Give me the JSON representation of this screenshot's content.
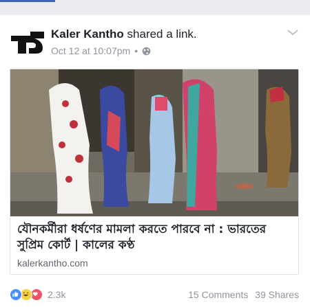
{
  "post": {
    "author": "Kaler Kantho",
    "action": "shared a link.",
    "timestamp": "Oct 12 at 10:07pm",
    "separator": "•",
    "privacy_icon": "globe-icon",
    "menu_icon": "chevron-down-icon"
  },
  "link_card": {
    "title": "যৌনকর্মীরা ধর্ষণের মামলা করতে পারবে না : ভারতের সুপ্রিম কোর্ট | কালের কণ্ঠ",
    "domain": "kalerkantho.com"
  },
  "engagement": {
    "reaction_icons": [
      "like-icon",
      "haha-icon",
      "love-icon"
    ],
    "reaction_count": "2.3k",
    "comments": "15 Comments",
    "shares": "39 Shares"
  },
  "colors": {
    "accent": "#4267b2",
    "meta_text": "#90949c",
    "like": "#4a8cff",
    "haha": "#f7d23b",
    "love": "#f25268"
  }
}
